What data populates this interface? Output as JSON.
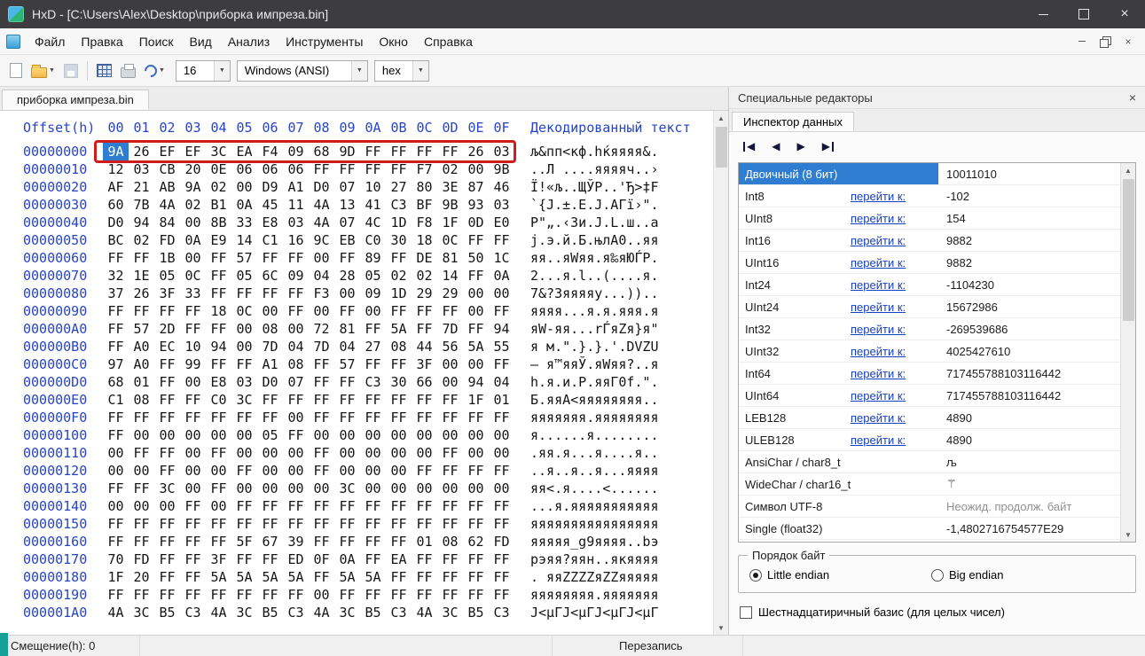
{
  "window": {
    "title": "HxD - [C:\\Users\\Alex\\Desktop\\приборка импреза.bin]"
  },
  "menu": {
    "items": [
      "Файл",
      "Правка",
      "Поиск",
      "Вид",
      "Анализ",
      "Инструменты",
      "Окно",
      "Справка"
    ]
  },
  "toolbar": {
    "icons": [
      "new-file",
      "open-file",
      "save",
      "sep",
      "export",
      "print",
      "undo"
    ],
    "bytes_per_row": "16",
    "charset": "Windows (ANSI)",
    "offset_base": "hex"
  },
  "tab": {
    "label": "приборка импреза.bin"
  },
  "hex_view": {
    "offset_header": "Offset(h)",
    "col_headers": [
      "00",
      "01",
      "02",
      "03",
      "04",
      "05",
      "06",
      "07",
      "08",
      "09",
      "0A",
      "0B",
      "0C",
      "0D",
      "0E",
      "0F"
    ],
    "decoded_header": "Декодированный текст",
    "rows": [
      {
        "offset": "00000000",
        "bytes": "9A 26 EF EF 3C EA F4 09 68 9D FF FF FF FF 26 03",
        "text": "љ&пп<кф.hќяяяя&."
      },
      {
        "offset": "00000010",
        "bytes": "12 03 CB 20 0E 06 06 06 FF FF FF FF F7 02 00 9B",
        "text": "..Л ....яяяяч..›"
      },
      {
        "offset": "00000020",
        "bytes": "AF 21 AB 9A 02 00 D9 A1 D0 07 10 27 80 3E 87 46",
        "text": "Ї!«љ..ЩЎР..'Ђ>‡F"
      },
      {
        "offset": "00000030",
        "bytes": "60 7B 4A 02 B1 0A 45 11 4A 13 41 C3 BF 9B 93 03",
        "text": "`{J.±.E.J.AГї›\"."
      },
      {
        "offset": "00000040",
        "bytes": "D0 94 84 00 8B 33 E8 03 4A 07 4C 1D F8 1F 0D E0",
        "text": "Р\"„.‹3и.J.L.ш..а"
      },
      {
        "offset": "00000050",
        "bytes": "BC 02 FD 0A E9 14 C1 16 9C EB C0 30 18 0C FF FF",
        "text": "ј.э.й.Б.њлА0..яя"
      },
      {
        "offset": "00000060",
        "bytes": "FF FF 1B 00 FF 57 FF FF 00 FF 89 FF DE 81 50 1C",
        "text": "яя..яWяя.я‰яЮЃP."
      },
      {
        "offset": "00000070",
        "bytes": "32 1E 05 0C FF 05 6C 09 04 28 05 02 02 14 FF 0A",
        "text": "2...я.l..(....я."
      },
      {
        "offset": "00000080",
        "bytes": "37 26 3F 33 FF FF FF FF F3 00 09 1D 29 29 00 00",
        "text": "7&?3яяяяу...)).."
      },
      {
        "offset": "00000090",
        "bytes": "FF FF FF FF 18 0C 00 FF 00 FF 00 FF FF FF 00 FF",
        "text": "яяяя...я.я.яяя.я"
      },
      {
        "offset": "000000A0",
        "bytes": "FF 57 2D FF FF 00 08 00 72 81 FF 5A FF 7D FF 94",
        "text": "яW-яя...rЃяZя}я\""
      },
      {
        "offset": "000000B0",
        "bytes": "FF A0 EC 10 94 00 7D 04 7D 04 27 08 44 56 5A 55",
        "text": "я м.\".}.}.'.DVZU"
      },
      {
        "offset": "000000C0",
        "bytes": "97 A0 FF 99 FF FF A1 08 FF 57 FF FF 3F 00 00 FF",
        "text": "— я™яяЎ.яWяя?..я"
      },
      {
        "offset": "000000D0",
        "bytes": "68 01 FF 00 E8 03 D0 07 FF FF C3 30 66 00 94 04",
        "text": "h.я.и.Р.яяГ0f.\"."
      },
      {
        "offset": "000000E0",
        "bytes": "C1 08 FF FF C0 3C FF FF FF FF FF FF FF FF 1F 01",
        "text": "Б.яяА<яяяяяяяя.."
      },
      {
        "offset": "000000F0",
        "bytes": "FF FF FF FF FF FF FF 00 FF FF FF FF FF FF FF FF",
        "text": "яяяяяяя.яяяяяяяя"
      },
      {
        "offset": "00000100",
        "bytes": "FF 00 00 00 00 00 05 FF 00 00 00 00 00 00 00 00",
        "text": "я......я........"
      },
      {
        "offset": "00000110",
        "bytes": "00 FF FF 00 FF 00 00 00 FF 00 00 00 00 FF 00 00",
        "text": ".яя.я...я....я.."
      },
      {
        "offset": "00000120",
        "bytes": "00 00 FF 00 00 FF 00 00 FF 00 00 00 FF FF FF FF",
        "text": "..я..я..я...яяяя"
      },
      {
        "offset": "00000130",
        "bytes": "FF FF 3C 00 FF 00 00 00 00 3C 00 00 00 00 00 00",
        "text": "яя<.я....<......"
      },
      {
        "offset": "00000140",
        "bytes": "00 00 00 FF 00 FF FF FF FF FF FF FF FF FF FF FF",
        "text": "...я.яяяяяяяяяяя"
      },
      {
        "offset": "00000150",
        "bytes": "FF FF FF FF FF FF FF FF FF FF FF FF FF FF FF FF",
        "text": "яяяяяяяяяяяяяяяя"
      },
      {
        "offset": "00000160",
        "bytes": "FF FF FF FF FF 5F 67 39 FF FF FF FF 01 08 62 FD",
        "text": "яяяяя_g9яяяя..bэ"
      },
      {
        "offset": "00000170",
        "bytes": "70 FD FF FF 3F FF FF ED 0F 0A FF EA FF FF FF FF",
        "text": "pэяя?яян..якяяяя"
      },
      {
        "offset": "00000180",
        "bytes": "1F 20 FF FF 5A 5A 5A 5A FF 5A 5A FF FF FF FF FF",
        "text": ". яяZZZZяZZяяяяя"
      },
      {
        "offset": "00000190",
        "bytes": "FF FF FF FF FF FF FF FF 00 FF FF FF FF FF FF FF",
        "text": "яяяяяяяя.яяяяяяя"
      },
      {
        "offset": "000001A0",
        "bytes": "4A 3C B5 C3 4A 3C B5 C3 4A 3C B5 C3 4A 3C B5 C3",
        "text": "J<µГJ<µГJ<µГJ<µГ"
      }
    ]
  },
  "inspector": {
    "panel_title": "Специальные редакторы",
    "tab": "Инспектор данных",
    "nav_icons": [
      "first",
      "previous",
      "next",
      "last"
    ],
    "goto_label": "перейти к:",
    "rows": [
      {
        "name": "Двоичный (8 бит)",
        "value": "10011010",
        "link": false,
        "selected": true
      },
      {
        "name": "Int8",
        "value": "-102",
        "link": true
      },
      {
        "name": "UInt8",
        "value": "154",
        "link": true
      },
      {
        "name": "Int16",
        "value": "9882",
        "link": true
      },
      {
        "name": "UInt16",
        "value": "9882",
        "link": true
      },
      {
        "name": "Int24",
        "value": "-1104230",
        "link": true
      },
      {
        "name": "UInt24",
        "value": "15672986",
        "link": true
      },
      {
        "name": "Int32",
        "value": "-269539686",
        "link": true
      },
      {
        "name": "UInt32",
        "value": "4025427610",
        "link": true
      },
      {
        "name": "Int64",
        "value": "717455788103116442",
        "link": true
      },
      {
        "name": "UInt64",
        "value": "717455788103116442",
        "link": true
      },
      {
        "name": "LEB128",
        "value": "4890",
        "link": true
      },
      {
        "name": "ULEB128",
        "value": "4890",
        "link": true
      },
      {
        "name": "AnsiChar / char8_t",
        "value": "љ",
        "link": false
      },
      {
        "name": "WideChar / char16_t",
        "value": "⚚",
        "link": false
      },
      {
        "name": "Символ UTF-8",
        "value": "Неожид. продолж. байт",
        "link": false,
        "muted": true
      },
      {
        "name": "Single (float32)",
        "value": "-1,4802716754577E29",
        "link": false
      }
    ],
    "byte_order": {
      "title": "Порядок байт",
      "options": [
        "Little endian",
        "Big endian"
      ],
      "selected": "Little endian"
    },
    "hex_basis_label": "Шестнадцатиричный базис (для целых чисел)"
  },
  "status": {
    "offset_label": "Смещение(h): 0",
    "mode": "Перезапись"
  }
}
